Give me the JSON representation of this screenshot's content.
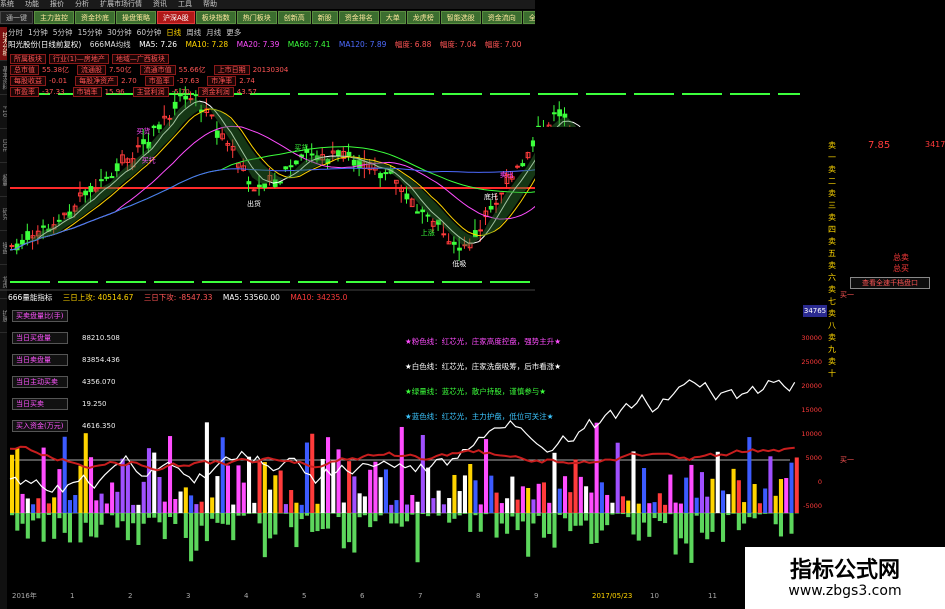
{
  "menu": [
    "系统",
    "功能",
    "报价",
    "分析",
    "扩展市场行情",
    "资讯",
    "工具",
    "帮助"
  ],
  "tabs": [
    {
      "label": "通一键",
      "style": "dark"
    },
    {
      "label": "主力监控",
      "style": "green"
    },
    {
      "label": "资金抄底",
      "style": "green"
    },
    {
      "label": "操盘策略",
      "style": "green"
    },
    {
      "label": "沪深A股",
      "style": "red"
    },
    {
      "label": "板块指数",
      "style": "green"
    },
    {
      "label": "热门板块",
      "style": "green"
    },
    {
      "label": "创新高",
      "style": "green"
    },
    {
      "label": "新股",
      "style": "green"
    },
    {
      "label": "资金排名",
      "style": "green"
    },
    {
      "label": "大单",
      "style": "green"
    },
    {
      "label": "龙虎榜",
      "style": "green"
    },
    {
      "label": "智能选股",
      "style": "green"
    },
    {
      "label": "资金流向",
      "style": "green"
    },
    {
      "label": "全球指数",
      "style": "green"
    }
  ],
  "periods": {
    "items": [
      "分时",
      "1分钟",
      "5分钟",
      "15分钟",
      "30分钟",
      "60分钟",
      "日线",
      "周线",
      "月线",
      "更多"
    ],
    "active": "日线"
  },
  "left_tabs": [
    "技术分析",
    "基本资料",
    "F10",
    "DDE",
    "超赢",
    "研究",
    "操盘",
    "龙虎",
    "扩展"
  ],
  "stock_line": {
    "name": "阳光股份(日线前复权)",
    "indicator": "666MA均线",
    "ma5": "MA5: 7.26",
    "ma10": "MA10: 7.28",
    "ma20": "MA20: 7.39",
    "ma60": "MA60: 7.41",
    "ma120": "MA120: 7.89",
    "right_a": "幅度: 6.88",
    "right_b": "幅度: 7.04",
    "right_c": "幅度: 7.00"
  },
  "info_box": {
    "rows": [
      [
        {
          "box": "所属板块",
          "val": ""
        },
        {
          "box": "行业(1)—房地产",
          "val": ""
        },
        {
          "box": "地域—广西板块",
          "val": ""
        }
      ],
      [
        {
          "box": "总市值",
          "val": "55.38亿"
        },
        {
          "box": "流通股",
          "val": "7.50亿"
        },
        {
          "box": "流通市值",
          "val": "55.66亿"
        },
        {
          "box": "上市日期",
          "val": "20130304"
        }
      ],
      [
        {
          "box": "每股收益",
          "val": "-0.01"
        },
        {
          "box": "每股净资产",
          "val": "2.70"
        },
        {
          "box": "市盈率",
          "val": "-37.63"
        },
        {
          "box": "市净率",
          "val": "2.74"
        }
      ],
      [
        {
          "box": "市盈率",
          "val": "-37.33"
        },
        {
          "box": "市销率",
          "val": "15.96"
        },
        {
          "box": "主营利润",
          "val": "-5.70"
        },
        {
          "box": "资金利润",
          "val": "43.57"
        }
      ]
    ]
  },
  "kline": {
    "ymin": 5.8,
    "ymax": 9.8,
    "ticks": [
      9.0,
      8.0,
      7.5,
      7.0,
      6.5,
      6.0
    ],
    "bars": [],
    "annotations": [
      "买货",
      "出货",
      "买货",
      "买托",
      "底托",
      "上涨",
      "卖出",
      "低吸",
      "中线",
      "卖托",
      "买托"
    ]
  },
  "vol_line": {
    "name": "666量能指标",
    "a": "三日上攻: 40514.67",
    "b": "三日下攻: -8547.33",
    "c": "MA5: 53560.00",
    "d": "MA10: 34235.0"
  },
  "flow_panel": [
    {
      "label": "买卖盘量比(手)",
      "value": ""
    },
    {
      "label": "当日买盘量",
      "value": "88210.508"
    },
    {
      "label": "当日卖盘量",
      "value": "83854.436"
    },
    {
      "label": "当日主动买卖",
      "value": "4356.070"
    },
    {
      "label": "当日买卖",
      "value": "19.250"
    },
    {
      "label": "买入资金(万元)",
      "value": "4616.350"
    }
  ],
  "legend": [
    {
      "text": "★粉色线：红芯光，庄家高度控盘，强势主升★",
      "color": "#ff4dff"
    },
    {
      "text": "★白色线：红芯光，庄家洗盘吸筹，后市看涨★",
      "color": "#ffffff"
    },
    {
      "text": "★绿量线：蓝芯光，散户持股，谨慎参与★",
      "color": "#3cff3c"
    },
    {
      "text": "★蓝色线：红芯光，主力护盘，低位可关注★",
      "color": "#3cc6ff"
    }
  ],
  "orderbook": {
    "code": "卖一卖二卖三卖四卖五卖六卖七卖八卖九卖十",
    "price": "7.85",
    "vol": "3417",
    "zm": [
      "总卖",
      "总买"
    ],
    "button": "查看全速千档盘口"
  },
  "vol_axis": {
    "top_badge": "34765",
    "ticks": [
      "30000",
      "25000",
      "20000",
      "15000",
      "10000",
      "5000",
      "0",
      "-5000"
    ],
    "sel1": "买一",
    "sel2": "买一"
  },
  "bottom_axis": [
    "2016年",
    "1",
    "2",
    "3",
    "4",
    "5",
    "6",
    "7",
    "8",
    "9",
    "2017/05/23",
    "10",
    "11",
    "12"
  ],
  "watermark": {
    "line1": "指标公式网",
    "line2": "www.zbgs3.com"
  }
}
